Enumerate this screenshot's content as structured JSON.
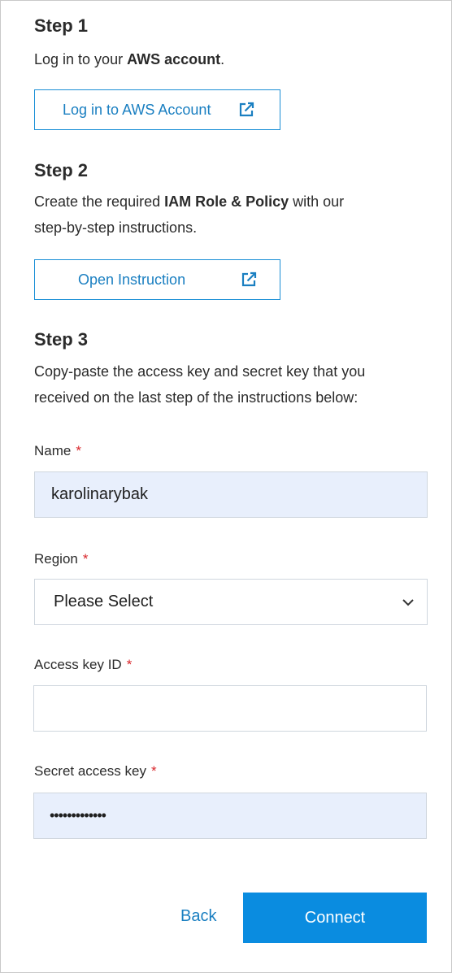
{
  "step1": {
    "title": "Step 1",
    "text_pre": "Log in to your ",
    "text_bold": "AWS account",
    "text_post": ".",
    "button_label": "Log in to AWS Account"
  },
  "step2": {
    "title": "Step 2",
    "text_pre": "Create the required ",
    "text_bold": "IAM Role & Policy",
    "text_post": " with our",
    "text_line2": "step-by-step instructions.",
    "button_label": "Open Instruction"
  },
  "step3": {
    "title": "Step 3",
    "text_line1": "Copy-paste the access key and secret key that you",
    "text_line2": "received on the last step of the instructions below:"
  },
  "form": {
    "required_mark": "*",
    "name": {
      "label": "Name",
      "value": "karolinarybak"
    },
    "region": {
      "label": "Region",
      "value": "Please Select"
    },
    "access_key_id": {
      "label": "Access key ID",
      "value": ""
    },
    "secret_access_key": {
      "label": "Secret access key",
      "value": "•••••••••••••"
    }
  },
  "actions": {
    "back_label": "Back",
    "connect_label": "Connect"
  },
  "colors": {
    "accent": "#0a8ce0",
    "link": "#1a7fc1",
    "required": "#d9262b",
    "filled_input_bg": "#e8effc"
  },
  "icons": {
    "external_link": "external-link-icon",
    "dropdown": "chevron-down-icon"
  }
}
